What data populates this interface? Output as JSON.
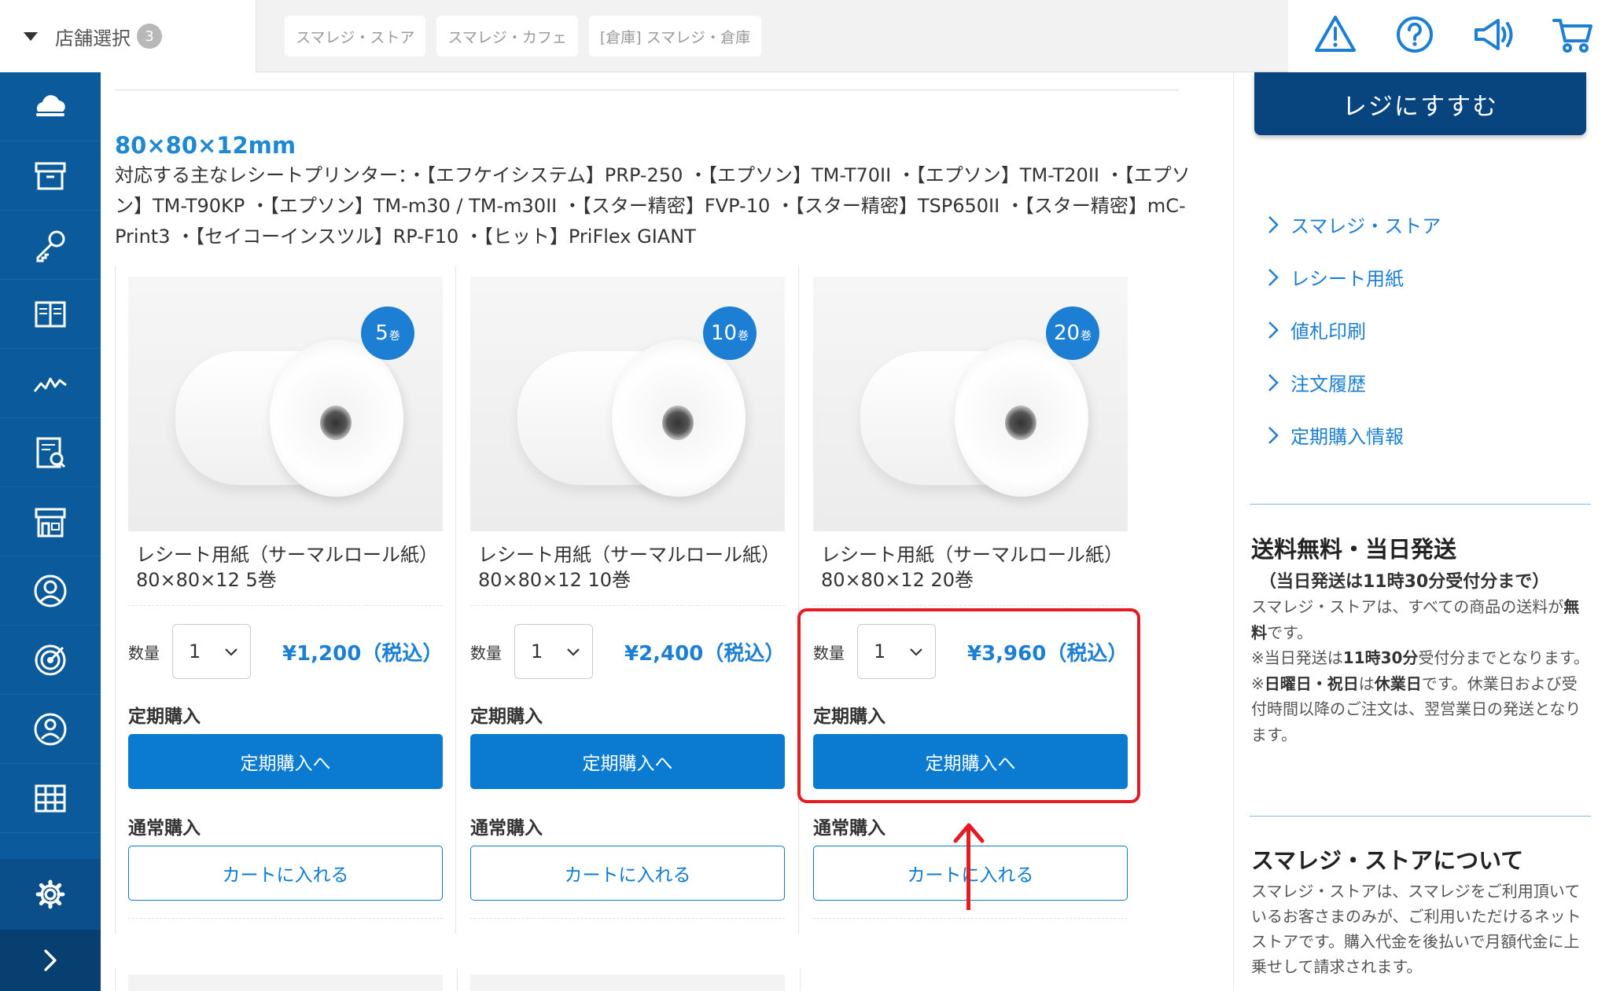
{
  "header": {
    "store_select_label": "店舗選択",
    "store_count": "3",
    "store_tabs": [
      "スマレジ・ストア",
      "スマレジ・カフェ",
      "[倉庫] スマレジ・倉庫"
    ],
    "icons": [
      "warning-icon",
      "help-icon",
      "megaphone-icon",
      "cart-icon"
    ]
  },
  "sidebar": {
    "icons": [
      "cloud-icon",
      "archive-box-icon",
      "key-icon",
      "book-icon",
      "chart-line-icon",
      "report-icon",
      "store-icon",
      "user-circle-icon",
      "target-icon",
      "user-icon",
      "grid-icon"
    ],
    "settings_icon": "gear-icon",
    "expand_icon": "chevron-right-icon"
  },
  "main": {
    "size_title": "80×80×12mm",
    "compat_text": "対応する主なレシートプリンター：・【エフケイシステム】PRP-250 ・【エプソン】TM-T70II ・【エプソン】TM-T20II ・【エプソン】TM-T90KP ・【エプソン】TM-m30 / TM-m30II ・【スター精密】FVP-10 ・【スター精密】TSP650II ・【スター精密】mC-Print3 ・【セイコーインスツル】RP-F10 ・【ヒット】PriFlex GIANT",
    "products": [
      {
        "badge_num": "5",
        "badge_unit": "巻",
        "name": "レシート用紙（サーマルロール紙）80×80×12 5巻",
        "qty_label": "数量",
        "qty_value": "1",
        "price": "¥1,200（税込）",
        "teiki_label": "定期購入",
        "teiki_button": "定期購入へ",
        "tsujo_label": "通常購入",
        "cart_button": "カートに入れる"
      },
      {
        "badge_num": "10",
        "badge_unit": "巻",
        "name": "レシート用紙（サーマルロール紙）80×80×12 10巻",
        "qty_label": "数量",
        "qty_value": "1",
        "price": "¥2,400（税込）",
        "teiki_label": "定期購入",
        "teiki_button": "定期購入へ",
        "tsujo_label": "通常購入",
        "cart_button": "カートに入れる"
      },
      {
        "badge_num": "20",
        "badge_unit": "巻",
        "name": "レシート用紙（サーマルロール紙）80×80×12 20巻",
        "qty_label": "数量",
        "qty_value": "1",
        "price": "¥3,960（税込）",
        "teiki_label": "定期購入",
        "teiki_button": "定期購入へ",
        "tsujo_label": "通常購入",
        "cart_button": "カートに入れる"
      }
    ]
  },
  "right": {
    "regi_button": "レジにすすむ",
    "nav": [
      "スマレジ・ストア",
      "レシート用紙",
      "値札印刷",
      "注文履歴",
      "定期購入情報"
    ],
    "shipping_title": "送料無料・当日発送",
    "shipping_sub": "（当日発送は11時30分受付分まで）",
    "shipping_line1_pre": "スマレジ・ストアは、すべての商品の送料が",
    "shipping_line1_bold": "無料",
    "shipping_line1_post": "です。",
    "shipping_line2_pre": "※当日発送は",
    "shipping_line2_bold": "11時30分",
    "shipping_line2_post": "受付分までとなります。",
    "shipping_line3_pre": "※",
    "shipping_line3_bold1": "日曜日・祝日",
    "shipping_line3_mid": "は",
    "shipping_line3_bold2": "休業日",
    "shipping_line3_post": "です。休業日および受付時間以降のご注文は、翌営業日の発送となります。",
    "about_title": "スマレジ・ストアについて",
    "about_body": "スマレジ・ストアは、スマレジをご利用頂いているお客さまのみが、ご利用いただけるネットストアです。購入代金を後払いで月額代金に上乗せして請求されます。"
  },
  "colors": {
    "accent": "#0a7bd1",
    "sidebar": "#0b5a9c",
    "highlight": "#e31b23"
  }
}
